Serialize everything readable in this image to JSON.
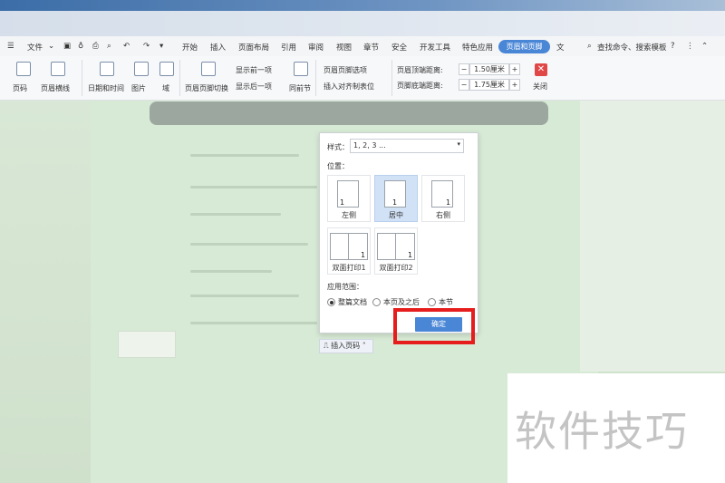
{
  "menubar": {
    "file": "文件",
    "items": [
      "开始",
      "插入",
      "页面布局",
      "引用",
      "审阅",
      "视图",
      "章节",
      "安全",
      "开发工具",
      "特色应用"
    ],
    "active_tab": "页眉和页脚",
    "overflow": "文",
    "search": "查找命令、搜索模板",
    "help": "?"
  },
  "ribbon": {
    "page_number": "页码",
    "header_line": "页眉横线",
    "date_time": "日期和时间",
    "picture": "图片",
    "field": "域",
    "header_footer_switch": "页眉页脚切换",
    "show_prev": "显示前一项",
    "show_next": "显示后一项",
    "same_as_prev": "同前节",
    "hf_options": "页眉页脚选项",
    "insert_align_tab": "插入对齐制表位",
    "header_top_distance_label": "页眉顶端距离:",
    "header_top_distance_value": "1.50厘米",
    "footer_bottom_distance_label": "页脚底端距离:",
    "footer_bottom_distance_value": "1.75厘米",
    "close": "关闭"
  },
  "popup": {
    "style_label": "样式：",
    "style_value": "1, 2, 3 ...",
    "position_label": "位置：",
    "positions": [
      {
        "label": "左侧",
        "num": "1"
      },
      {
        "label": "居中",
        "num": "1"
      },
      {
        "label": "右侧",
        "num": "1"
      },
      {
        "label": "双面打印1",
        "num": "1"
      },
      {
        "label": "双面打印2",
        "num": "1"
      }
    ],
    "scope_label": "应用范围：",
    "scope_options": [
      "整篇文档",
      "本页及之后",
      "本节"
    ],
    "ok": "确定"
  },
  "insert_page_number": "插入页码",
  "watermark": "软件技巧",
  "colors": {
    "accent": "#4a86d6",
    "highlight": "#e51d1d"
  }
}
